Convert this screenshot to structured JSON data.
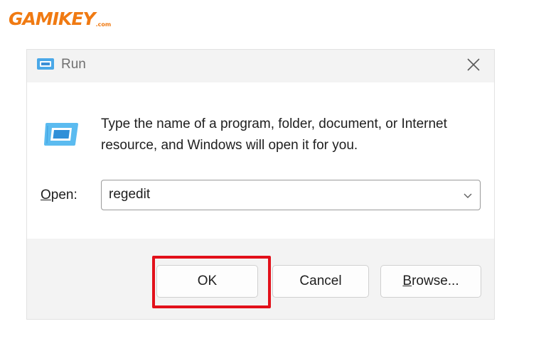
{
  "logo": {
    "text": "GAMIKEY",
    "suffix": ".com"
  },
  "dialog": {
    "title": "Run",
    "description": "Type the name of a program, folder, document, or Internet resource, and Windows will open it for you.",
    "open_label_accel": "O",
    "open_label_rest": "pen:",
    "open_value": "regedit",
    "buttons": {
      "ok": "OK",
      "cancel": "Cancel",
      "browse_accel": "B",
      "browse_rest": "rowse..."
    }
  },
  "colors": {
    "highlight": "#e2101a",
    "logo": "#f07a12",
    "titlebar": "#f3f3f3"
  }
}
